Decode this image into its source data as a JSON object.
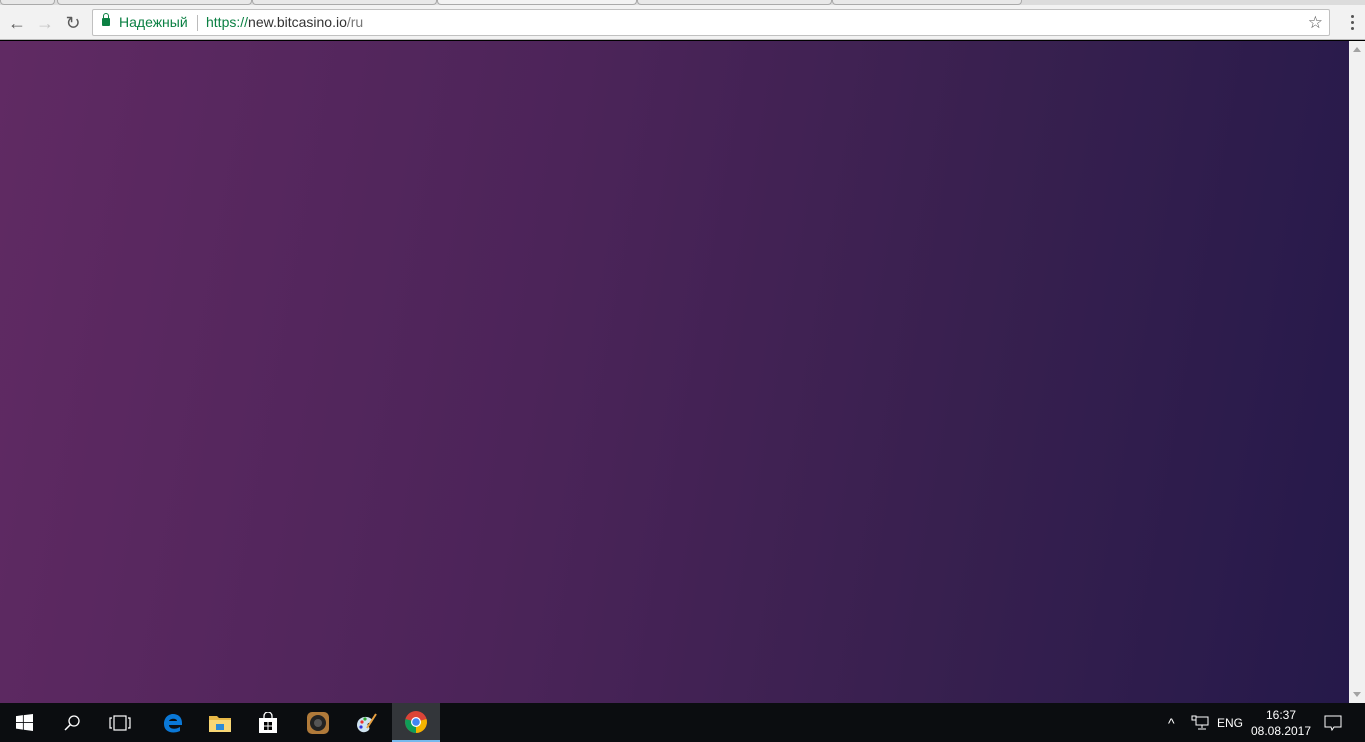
{
  "browser": {
    "secure_label": "Надежный",
    "url_scheme": "https://",
    "url_host": "new.bitcasino.io",
    "url_path": "/ru"
  },
  "page": {
    "gradient_start": "#602a63",
    "gradient_end": "#25194a"
  },
  "taskbar": {
    "apps": [
      "start-icon",
      "search-icon",
      "task-view-icon",
      "edge-icon",
      "file-explorer-icon",
      "store-icon",
      "speaker-app-icon",
      "paint-icon",
      "chrome-icon"
    ],
    "language": "ENG",
    "time": "16:37",
    "date": "08.08.2017"
  }
}
